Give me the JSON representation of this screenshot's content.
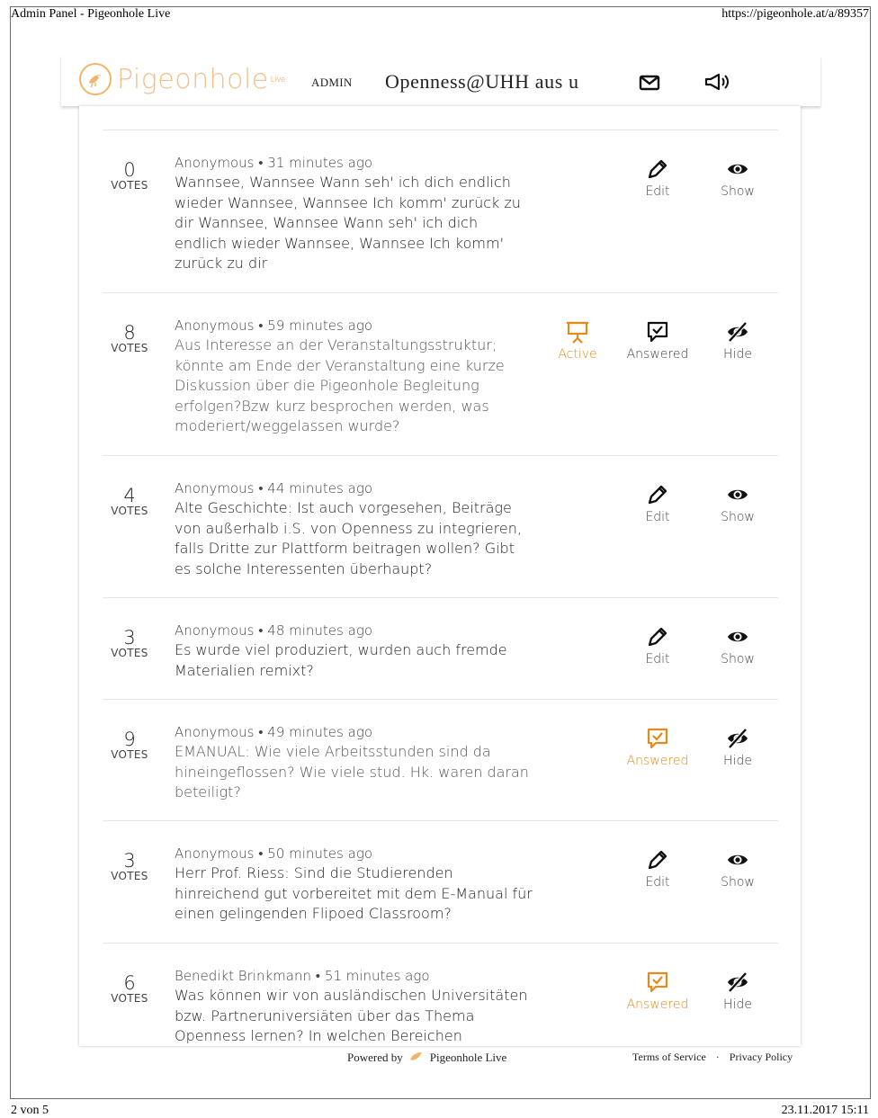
{
  "print": {
    "title": "Admin Panel - Pigeonhole Live",
    "url": "https://pigeonhole.at/a/89357",
    "page": "2 von 5",
    "datetime": "23.11.2017 15:11"
  },
  "header": {
    "logo_text": "Pigeonhole",
    "logo_live": "Live",
    "admin_label": "ADMIN",
    "event_title": "Openness@UHH aus u",
    "icons": [
      "mail-icon",
      "megaphone-icon"
    ]
  },
  "questions": [
    {
      "votes": "0",
      "votes_label": "VOTES",
      "author": "Anonymous",
      "separator": "•",
      "time": "31 minutes ago",
      "text": "Wannsee, Wannsee Wann seh' ich dich endlich wieder Wannsee, Wannsee Ich komm' zurück zu dir Wannsee, Wannsee Wann seh' ich dich endlich wieder Wannsee, Wannsee Ich komm' zurück zu dir",
      "actions": [
        {
          "label": "Edit",
          "icon": "pencil-icon"
        },
        {
          "label": "Show",
          "icon": "eye-icon"
        }
      ]
    },
    {
      "votes": "8",
      "votes_label": "VOTES",
      "author": "Anonymous",
      "separator": "•",
      "time": "59 minutes ago",
      "text": "Aus Interesse an der Veranstaltungsstruktur; könnte am Ende der Veranstaltung eine kurze Diskussion über die Pigeonhole Begleitung erfolgen?Bzw kurz besprochen werden, was moderiert/weggelassen wurde?",
      "actions": [
        {
          "label": "Active",
          "icon": "presentation-icon",
          "color": "#e38b1e"
        },
        {
          "label": "Answered",
          "icon": "answered-icon"
        },
        {
          "label": "Hide",
          "icon": "eye-slash-icon"
        }
      ]
    },
    {
      "votes": "4",
      "votes_label": "VOTES",
      "author": "Anonymous",
      "separator": "•",
      "time": "44 minutes ago",
      "text": "Alte Geschichte: Ist auch vorgesehen, Beiträge von außerhalb i.S. von Openness zu integrieren, falls Dritte zur Plattform beitragen wollen? Gibt es solche Interessenten überhaupt?",
      "actions": [
        {
          "label": "Edit",
          "icon": "pencil-icon"
        },
        {
          "label": "Show",
          "icon": "eye-icon"
        }
      ]
    },
    {
      "votes": "3",
      "votes_label": "VOTES",
      "author": "Anonymous",
      "separator": "•",
      "time": "48 minutes ago",
      "text": "Es wurde viel produziert, wurden auch fremde Materialien remixt?",
      "actions": [
        {
          "label": "Edit",
          "icon": "pencil-icon"
        },
        {
          "label": "Show",
          "icon": "eye-icon"
        }
      ]
    },
    {
      "votes": "9",
      "votes_label": "VOTES",
      "author": "Anonymous",
      "separator": "•",
      "time": "49 minutes ago",
      "text": "EMANUAL: Wie viele Arbeitsstunden sind da hineingeflossen? Wie viele stud. Hk. waren daran beteiligt?",
      "actions": [
        {
          "label": "Answered",
          "icon": "answered-icon",
          "color": "#e38b1e"
        },
        {
          "label": "Hide",
          "icon": "eye-slash-icon"
        }
      ]
    },
    {
      "votes": "3",
      "votes_label": "VOTES",
      "author": "Anonymous",
      "separator": "•",
      "time": "50 minutes ago",
      "text": "Herr Prof. Riess: Sind die Studierenden hinreichend gut vorbereitet mit dem E-Manual für einen gelingenden Flipoed Classroom?",
      "actions": [
        {
          "label": "Edit",
          "icon": "pencil-icon"
        },
        {
          "label": "Show",
          "icon": "eye-icon"
        }
      ]
    },
    {
      "votes": "6",
      "votes_label": "VOTES",
      "author": "Benedikt Brinkmann",
      "separator": "•",
      "time": "51 minutes ago",
      "text": "Was können wir von ausländischen Universitäten bzw. Partneruniversiäten über das Thema Openness lernen? In welchen Bereichen",
      "actions": [
        {
          "label": "Answered",
          "icon": "answered-icon",
          "color": "#e38b1e"
        },
        {
          "label": "Hide",
          "icon": "eye-slash-icon"
        }
      ]
    }
  ],
  "footer": {
    "powered_by": "Powered by",
    "brand": "Pigeonhole Live",
    "terms": "Terms of Service",
    "separator": "·",
    "privacy": "Privacy Policy"
  }
}
